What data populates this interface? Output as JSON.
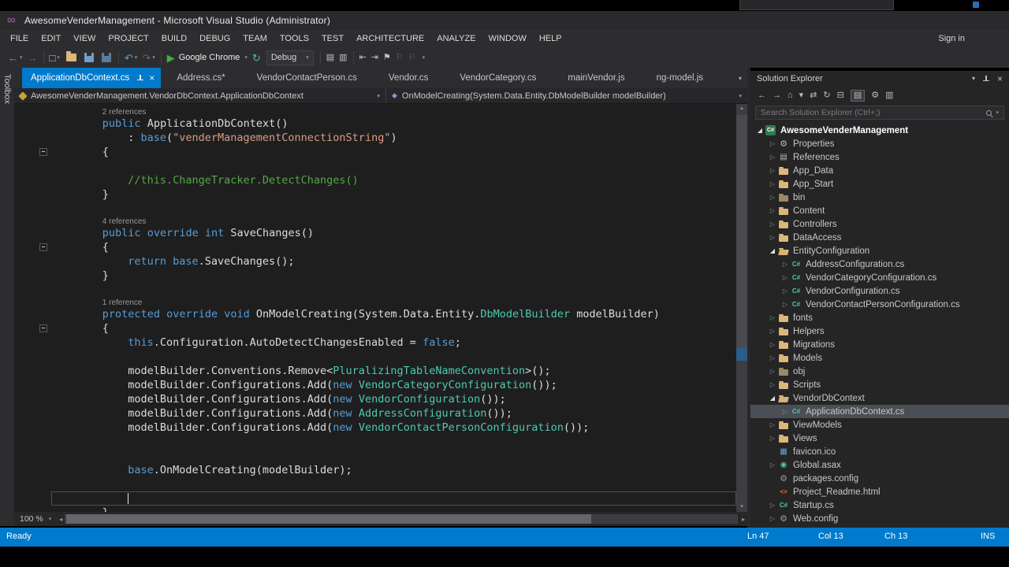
{
  "icons": {
    "infinity": "∞",
    "back": "←",
    "forward": "→",
    "dropdown": "▾",
    "up_arrow": "▴",
    "down_arrow": "▾",
    "left_arrow": "◂",
    "right_arrow": "▸",
    "play": "▶",
    "undo": "↶",
    "redo": "↷",
    "refresh": "↻",
    "home": "⌂",
    "sync": "⇄",
    "collapse_all": "⊟",
    "list": "▤",
    "columns": "▥",
    "gear": "⚙",
    "flag": "⚑",
    "flag_outline": "⚐",
    "new_file": "□",
    "close": "×",
    "outdent": "⇤",
    "indent": "⇥",
    "tree_collapsed": "▷",
    "tree_expanded": "◢",
    "method": "◆",
    "grid": "▦",
    "globe": "◉",
    "cs_label": "C#",
    "html_label": "<>"
  },
  "window": {
    "title": "AwesomeVenderManagement - Microsoft Visual Studio (Administrator)",
    "sign_in": "Sign in"
  },
  "menu": {
    "items": [
      "FILE",
      "EDIT",
      "VIEW",
      "PROJECT",
      "BUILD",
      "DEBUG",
      "TEAM",
      "TOOLS",
      "TEST",
      "ARCHITECTURE",
      "ANALYZE",
      "WINDOW",
      "HELP"
    ]
  },
  "toolbar": {
    "run_target": "Google Chrome",
    "configuration": "Debug"
  },
  "tabs": [
    {
      "label": "ApplicationDbContext.cs",
      "active": true
    },
    {
      "label": "Address.cs*",
      "active": false
    },
    {
      "label": "VendorContactPerson.cs",
      "active": false
    },
    {
      "label": "Vendor.cs",
      "active": false
    },
    {
      "label": "VendorCategory.cs",
      "active": false
    },
    {
      "label": "mainVendor.js",
      "active": false
    },
    {
      "label": "ng-model.js",
      "active": false
    }
  ],
  "navbar": {
    "scope": "AwesomeVenderManagement.VendorDbContext.ApplicationDbContext",
    "member": "OnModelCreating(System.Data.Entity.DbModelBuilder modelBuilder)"
  },
  "editor": {
    "zoom": "100 %",
    "lines": [
      {
        "kind": "lens",
        "ind": 8,
        "text": "2 references"
      },
      {
        "kind": "code",
        "ind": 8,
        "seg": [
          [
            "k",
            "public"
          ],
          [
            "p",
            " ApplicationDbContext()"
          ]
        ]
      },
      {
        "kind": "code",
        "ind": 12,
        "seg": [
          [
            "p",
            ": "
          ],
          [
            "k",
            "base"
          ],
          [
            "p",
            "("
          ],
          [
            "s",
            "\"venderManagementConnectionString\""
          ],
          [
            "p",
            ")"
          ]
        ]
      },
      {
        "kind": "code",
        "ind": 8,
        "fold": true,
        "seg": [
          [
            "p",
            "{"
          ]
        ]
      },
      {
        "kind": "code",
        "ind": 0,
        "seg": []
      },
      {
        "kind": "code",
        "ind": 12,
        "seg": [
          [
            "c",
            "//this.ChangeTracker.DetectChanges()"
          ]
        ]
      },
      {
        "kind": "code",
        "ind": 8,
        "seg": [
          [
            "p",
            "}"
          ]
        ]
      },
      {
        "kind": "code",
        "ind": 0,
        "seg": []
      },
      {
        "kind": "lens",
        "ind": 8,
        "text": "4 references"
      },
      {
        "kind": "code",
        "ind": 8,
        "seg": [
          [
            "k",
            "public override int"
          ],
          [
            "p",
            " SaveChanges()"
          ]
        ]
      },
      {
        "kind": "code",
        "ind": 8,
        "fold": true,
        "seg": [
          [
            "p",
            "{"
          ]
        ]
      },
      {
        "kind": "code",
        "ind": 12,
        "seg": [
          [
            "k",
            "return"
          ],
          [
            "p",
            " "
          ],
          [
            "k",
            "base"
          ],
          [
            "p",
            ".SaveChanges();"
          ]
        ]
      },
      {
        "kind": "code",
        "ind": 8,
        "seg": [
          [
            "p",
            "}"
          ]
        ]
      },
      {
        "kind": "code",
        "ind": 0,
        "seg": []
      },
      {
        "kind": "lens",
        "ind": 8,
        "text": "1 reference"
      },
      {
        "kind": "code",
        "ind": 8,
        "seg": [
          [
            "k",
            "protected override void"
          ],
          [
            "p",
            " OnModelCreating(System.Data.Entity."
          ],
          [
            "t",
            "DbModelBuilder"
          ],
          [
            "p",
            " modelBuilder)"
          ]
        ]
      },
      {
        "kind": "code",
        "ind": 8,
        "fold": true,
        "seg": [
          [
            "p",
            "{"
          ]
        ]
      },
      {
        "kind": "code",
        "ind": 12,
        "seg": [
          [
            "k",
            "this"
          ],
          [
            "p",
            ".Configuration.AutoDetectChangesEnabled = "
          ],
          [
            "k",
            "false"
          ],
          [
            "p",
            ";"
          ]
        ]
      },
      {
        "kind": "code",
        "ind": 0,
        "seg": []
      },
      {
        "kind": "code",
        "ind": 12,
        "seg": [
          [
            "p",
            "modelBuilder.Conventions.Remove<"
          ],
          [
            "t",
            "PluralizingTableNameConvention"
          ],
          [
            "p",
            ">();"
          ]
        ]
      },
      {
        "kind": "code",
        "ind": 12,
        "seg": [
          [
            "p",
            "modelBuilder.Configurations.Add("
          ],
          [
            "k",
            "new"
          ],
          [
            "p",
            " "
          ],
          [
            "t",
            "VendorCategoryConfiguration"
          ],
          [
            "p",
            "());"
          ]
        ]
      },
      {
        "kind": "code",
        "ind": 12,
        "seg": [
          [
            "p",
            "modelBuilder.Configurations.Add("
          ],
          [
            "k",
            "new"
          ],
          [
            "p",
            " "
          ],
          [
            "t",
            "VendorConfiguration"
          ],
          [
            "p",
            "());"
          ]
        ]
      },
      {
        "kind": "code",
        "ind": 12,
        "seg": [
          [
            "p",
            "modelBuilder.Configurations.Add("
          ],
          [
            "k",
            "new"
          ],
          [
            "p",
            " "
          ],
          [
            "t",
            "AddressConfiguration"
          ],
          [
            "p",
            "());"
          ]
        ]
      },
      {
        "kind": "code",
        "ind": 12,
        "seg": [
          [
            "p",
            "modelBuilder.Configurations.Add("
          ],
          [
            "k",
            "new"
          ],
          [
            "p",
            " "
          ],
          [
            "t",
            "VendorContactPersonConfiguration"
          ],
          [
            "p",
            "());"
          ]
        ]
      },
      {
        "kind": "code",
        "ind": 0,
        "seg": []
      },
      {
        "kind": "code",
        "ind": 0,
        "seg": []
      },
      {
        "kind": "code",
        "ind": 12,
        "seg": [
          [
            "k",
            "base"
          ],
          [
            "p",
            ".OnModelCreating(modelBuilder);"
          ]
        ]
      },
      {
        "kind": "code",
        "ind": 0,
        "seg": []
      },
      {
        "kind": "code",
        "ind": 12,
        "cursor": true,
        "seg": []
      },
      {
        "kind": "code",
        "ind": 8,
        "seg": [
          [
            "p",
            "}"
          ]
        ]
      }
    ]
  },
  "solution_explorer": {
    "title": "Solution Explorer",
    "search_placeholder": "Search Solution Explorer (Ctrl+;)",
    "tree": [
      {
        "label": "AwesomeVenderManagement",
        "level": 0,
        "icon": "csproj",
        "arrow": "exp",
        "bold": true
      },
      {
        "label": "Properties",
        "level": 1,
        "icon": "properties",
        "arrow": "col"
      },
      {
        "label": "References",
        "level": 1,
        "icon": "references",
        "arrow": "col"
      },
      {
        "label": "App_Data",
        "level": 1,
        "icon": "folder",
        "arrow": "col"
      },
      {
        "label": "App_Start",
        "level": 1,
        "icon": "folder",
        "arrow": "col"
      },
      {
        "label": "bin",
        "level": 1,
        "icon": "folder-dim",
        "arrow": "col"
      },
      {
        "label": "Content",
        "level": 1,
        "icon": "folder",
        "arrow": "col"
      },
      {
        "label": "Controllers",
        "level": 1,
        "icon": "folder",
        "arrow": "col"
      },
      {
        "label": "DataAccess",
        "level": 1,
        "icon": "folder",
        "arrow": "col"
      },
      {
        "label": "EntityConfiguration",
        "level": 1,
        "icon": "folder-open",
        "arrow": "exp"
      },
      {
        "label": "AddressConfiguration.cs",
        "level": 2,
        "icon": "cs",
        "arrow": "col"
      },
      {
        "label": "VendorCategoryConfiguration.cs",
        "level": 2,
        "icon": "cs",
        "arrow": "col"
      },
      {
        "label": "VendorConfiguration.cs",
        "level": 2,
        "icon": "cs",
        "arrow": "col"
      },
      {
        "label": "VendorContactPersonConfiguration.cs",
        "level": 2,
        "icon": "cs",
        "arrow": "col"
      },
      {
        "label": "fonts",
        "level": 1,
        "icon": "folder",
        "arrow": "col"
      },
      {
        "label": "Helpers",
        "level": 1,
        "icon": "folder",
        "arrow": "col"
      },
      {
        "label": "Migrations",
        "level": 1,
        "icon": "folder",
        "arrow": "col"
      },
      {
        "label": "Models",
        "level": 1,
        "icon": "folder",
        "arrow": "col"
      },
      {
        "label": "obj",
        "level": 1,
        "icon": "folder-dim",
        "arrow": "col"
      },
      {
        "label": "Scripts",
        "level": 1,
        "icon": "folder",
        "arrow": "col"
      },
      {
        "label": "VendorDbContext",
        "level": 1,
        "icon": "folder-open",
        "arrow": "exp"
      },
      {
        "label": "ApplicationDbContext.cs",
        "level": 2,
        "icon": "cs",
        "arrow": "col",
        "selected": true
      },
      {
        "label": "ViewModels",
        "level": 1,
        "icon": "folder",
        "arrow": "col"
      },
      {
        "label": "Views",
        "level": 1,
        "icon": "folder",
        "arrow": "col"
      },
      {
        "label": "favicon.ico",
        "level": 1,
        "icon": "ico",
        "arrow": "none"
      },
      {
        "label": "Global.asax",
        "level": 1,
        "icon": "asax",
        "arrow": "col"
      },
      {
        "label": "packages.config",
        "level": 1,
        "icon": "config",
        "arrow": "none"
      },
      {
        "label": "Project_Readme.html",
        "level": 1,
        "icon": "html",
        "arrow": "none"
      },
      {
        "label": "Startup.cs",
        "level": 1,
        "icon": "cs",
        "arrow": "col"
      },
      {
        "label": "Web.config",
        "level": 1,
        "icon": "config",
        "arrow": "col"
      }
    ]
  },
  "toolbox": {
    "label": "Toolbox"
  },
  "status": {
    "ready": "Ready",
    "line": "Ln 47",
    "column": "Col 13",
    "character": "Ch 13",
    "mode": "INS"
  }
}
